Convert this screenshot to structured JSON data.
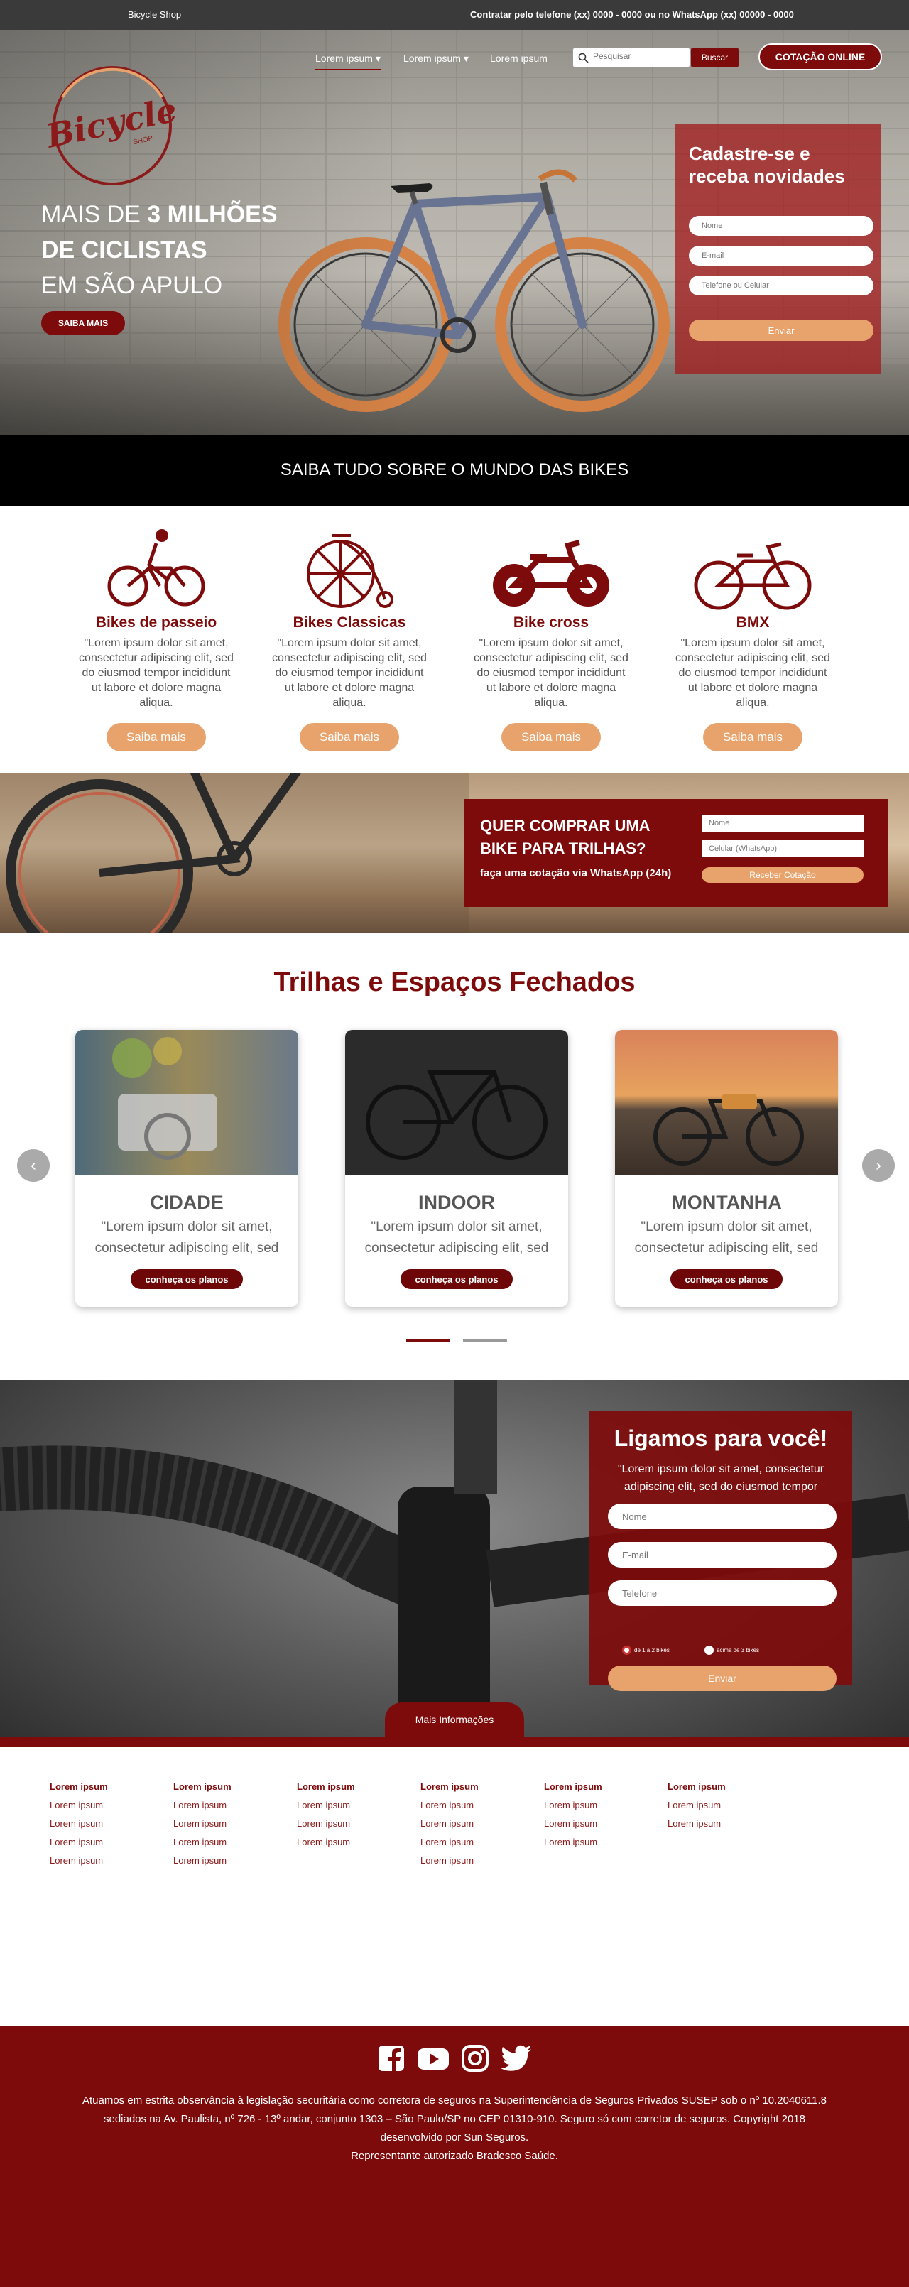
{
  "topbar": {
    "shop_name": "Bicycle Shop",
    "contact": "Contratar pelo telefone (xx) 0000 - 0000 ou no WhatsApp (xx) 00000 - 0000"
  },
  "nav": {
    "items": [
      {
        "label": "Lorem ipsum",
        "has_dropdown": true,
        "active": true
      },
      {
        "label": "Lorem ipsum",
        "has_dropdown": true,
        "active": false
      },
      {
        "label": "Lorem ipsum",
        "has_dropdown": false,
        "active": false
      }
    ],
    "search_placeholder": "Pesquisar",
    "search_button": "Buscar",
    "cta": "COTAÇÃO ONLINE"
  },
  "logo": {
    "text": "Bicycle",
    "sub": "SHOP"
  },
  "hero": {
    "line1_pre": "MAIS DE ",
    "line1_bold": "3 MILHÕES",
    "line2": "DE CICLISTAS",
    "line3": "EM SÃO APULO",
    "button": "SAIBA MAIS"
  },
  "signup": {
    "title": "Cadastre-se e receba novidades",
    "name_placeholder": "Nome",
    "email_placeholder": "E-mail",
    "phone_placeholder": "Telefone ou Celular",
    "button": "Enviar"
  },
  "band": {
    "text": "SAIBA TUDO SOBRE O MUNDO DAS BIKES"
  },
  "categories": [
    {
      "icon": "cyclist-icon",
      "title": "Bikes de passeio",
      "text": "\"Lorem ipsum dolor sit amet, consectetur adipiscing elit, sed do eiusmod tempor incididunt ut labore et dolore magna aliqua.",
      "button": "Saiba mais"
    },
    {
      "icon": "penny-farthing-icon",
      "title": "Bikes Classicas",
      "text": "\"Lorem ipsum dolor sit amet, consectetur adipiscing elit, sed do eiusmod tempor incididunt ut labore et dolore magna aliqua.",
      "button": "Saiba mais"
    },
    {
      "icon": "cross-bike-icon",
      "title": "Bike cross",
      "text": "\"Lorem ipsum dolor sit amet, consectetur adipiscing elit, sed do eiusmod tempor incididunt ut labore et dolore magna aliqua.",
      "button": "Saiba mais"
    },
    {
      "icon": "bmx-icon",
      "title": "BMX",
      "text": "\"Lorem ipsum dolor sit amet, consectetur adipiscing elit, sed do eiusmod tempor incididunt ut labore et dolore magna aliqua.",
      "button": "Saiba mais"
    }
  ],
  "trail": {
    "title_line1": "QUER COMPRAR UMA",
    "title_line2": "BIKE PARA TRILHAS?",
    "subtitle": "faça uma cotação via WhatsApp (24h)",
    "name_placeholder": "Nome",
    "phone_placeholder": "Celular (WhatsApp)",
    "button": "Receber Cotação"
  },
  "trilhas": {
    "title": "Trilhas e Espaços Fechados",
    "cards": [
      {
        "title": "CIDADE",
        "text": "\"Lorem ipsum dolor sit amet, consectetur adipiscing elit, sed",
        "button": "conheça os planos"
      },
      {
        "title": "INDOOR",
        "text": "\"Lorem ipsum dolor sit amet, consectetur adipiscing elit, sed",
        "button": "conheça os planos"
      },
      {
        "title": "MONTANHA",
        "text": "\"Lorem ipsum dolor sit amet, consectetur adipiscing elit, sed",
        "button": "conheça os planos"
      }
    ],
    "prev_icon": "chevron-left-icon",
    "next_icon": "chevron-right-icon",
    "active_slide": 1,
    "slide_count": 2
  },
  "call": {
    "title": "Ligamos para você!",
    "text": "\"Lorem ipsum dolor sit amet, consectetur adipiscing elit, sed do eiusmod tempor",
    "name_placeholder": "Nome",
    "email_placeholder": "E-mail",
    "phone_placeholder": "Telefone",
    "option1": "de 1 a 2 bikes",
    "option2": "acima de 3 bikes",
    "button": "Enviar"
  },
  "more_info": "Mais Informações",
  "footer_links": [
    {
      "heading": "Lorem ipsum",
      "items": [
        "Lorem ipsum",
        "Lorem ipsum",
        "Lorem ipsum",
        "Lorem ipsum"
      ]
    },
    {
      "heading": "Lorem ipsum",
      "items": [
        "Lorem ipsum",
        "Lorem ipsum",
        "Lorem ipsum",
        "Lorem ipsum"
      ]
    },
    {
      "heading": "Lorem ipsum",
      "items": [
        "Lorem ipsum",
        "Lorem ipsum",
        "Lorem ipsum"
      ]
    },
    {
      "heading": "Lorem ipsum",
      "items": [
        "Lorem ipsum",
        "Lorem ipsum",
        "Lorem ipsum",
        "Lorem ipsum"
      ]
    },
    {
      "heading": "Lorem ipsum",
      "items": [
        "Lorem ipsum",
        "Lorem ipsum",
        "Lorem ipsum"
      ]
    },
    {
      "heading": "Lorem ipsum",
      "items": [
        "Lorem ipsum",
        "Lorem ipsum"
      ]
    }
  ],
  "footer": {
    "social": [
      "facebook-icon",
      "youtube-icon",
      "instagram-icon",
      "twitter-icon"
    ],
    "legal_line1": "Atuamos em estrita observância à legislação securitária como corretora de seguros na Superintendência de Seguros Privados SUSEP sob o nº 10.2040611.8",
    "legal_line2": "sediados na Av. Paulista, nº 726 - 13º andar, conjunto 1303 – São Paulo/SP no CEP 01310-910. Seguro só com corretor de seguros. Copyright  2018",
    "legal_line3": "desenvolvido por Sun Seguros.",
    "legal_line4": "Representante autorizado Bradesco Saúde."
  },
  "colors": {
    "brand": "#7e0b0b",
    "accent": "#e8a26b",
    "topbar": "#3a3a3a",
    "band": "#000000"
  }
}
